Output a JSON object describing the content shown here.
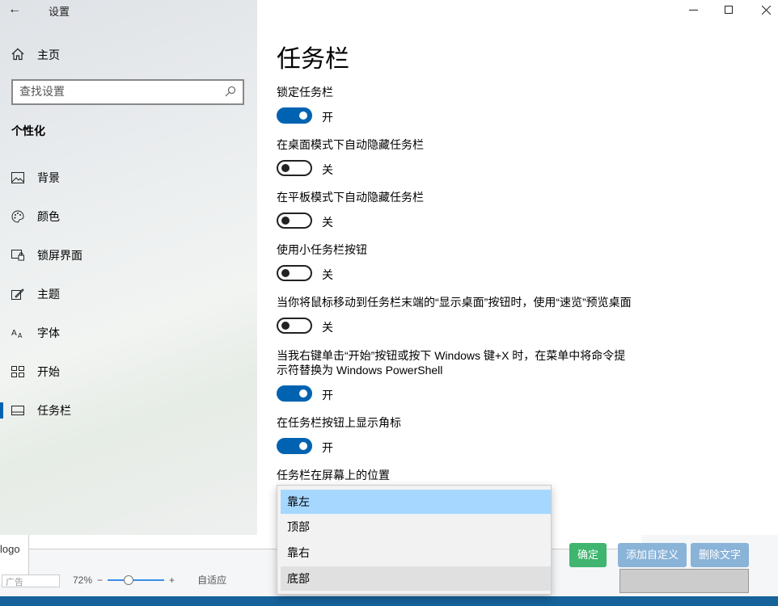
{
  "window": {
    "title": "设置",
    "back_icon": "back-arrow-icon"
  },
  "sidebar": {
    "home_label": "主页",
    "search_placeholder": "查找设置",
    "section": "个性化",
    "items": [
      {
        "label": "背景",
        "icon": "picture-icon"
      },
      {
        "label": "颜色",
        "icon": "palette-icon"
      },
      {
        "label": "锁屏界面",
        "icon": "lock-screen-icon"
      },
      {
        "label": "主题",
        "icon": "theme-icon"
      },
      {
        "label": "字体",
        "icon": "font-icon"
      },
      {
        "label": "开始",
        "icon": "start-icon"
      },
      {
        "label": "任务栏",
        "icon": "taskbar-icon",
        "active": true
      }
    ]
  },
  "main": {
    "title": "任务栏",
    "settings": [
      {
        "label": "锁定任务栏",
        "state": "开",
        "on": true
      },
      {
        "label": "在桌面模式下自动隐藏任务栏",
        "state": "关",
        "on": false
      },
      {
        "label": "在平板模式下自动隐藏任务栏",
        "state": "关",
        "on": false
      },
      {
        "label": "使用小任务栏按钮",
        "state": "关",
        "on": false
      },
      {
        "label": "当你将鼠标移动到任务栏末端的“显示桌面”按钮时，使用“速览”预览桌面",
        "state": "关",
        "on": false
      },
      {
        "label_line1": "当我右键单击“开始”按钮或按下 Windows 键+X 时，在菜单中将命令提",
        "label_line2": "示符替换为 Windows PowerShell",
        "state": "开",
        "on": true
      },
      {
        "label": "在任务栏按钮上显示角标",
        "state": "开",
        "on": true
      }
    ],
    "position_label": "任务栏在屏幕上的位置",
    "position_options": [
      "靠左",
      "顶部",
      "靠右",
      "底部"
    ],
    "position_selected": "靠左"
  },
  "background_app": {
    "logo_text": "logo",
    "ad_text": "广告",
    "zoom": "72%",
    "fit_label": "自适应",
    "ok_button": "确定",
    "add_custom_button": "添加自定义",
    "delete_text_button": "删除文字"
  },
  "colors": {
    "accent": "#0063b1",
    "selected_option": "#a6d8ff"
  }
}
